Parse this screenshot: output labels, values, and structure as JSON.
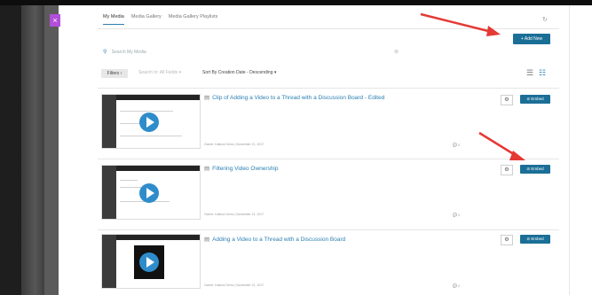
{
  "tabs": [
    {
      "label": "My Media"
    },
    {
      "label": "Media Gallery"
    },
    {
      "label": "Media Gallery Playlists"
    }
  ],
  "close_glyph": "×",
  "refresh_icon": "↻",
  "toolbar": {
    "add_new_label": "+ Add New",
    "search_placeholder": "Search My Media",
    "filters_label": "Filters",
    "filter_select": "Search In: All Fields",
    "sort_select": "Sort By Creation Date - Descending"
  },
  "items": [
    {
      "title": "Clip of Adding a Video to a Thread with a Discussion Board - Edited",
      "owner": "Owner: Kaltura Demo | November 21, 2017",
      "comments": "0",
      "embed_label": "Embed"
    },
    {
      "title": "Filtering Video Ownership",
      "owner": "Owner: Kaltura Demo | November 21, 2017",
      "comments": "0",
      "embed_label": "Embed"
    },
    {
      "title": "Adding a Video to a Thread with a Discussion Board",
      "owner": "Owner: Kaltura Demo | November 21, 2017",
      "comments": "0",
      "embed_label": "Embed"
    }
  ],
  "colors": {
    "accent": "#1b6f97",
    "link": "#2a7fb3",
    "annotation_arrow": "#e53935"
  }
}
